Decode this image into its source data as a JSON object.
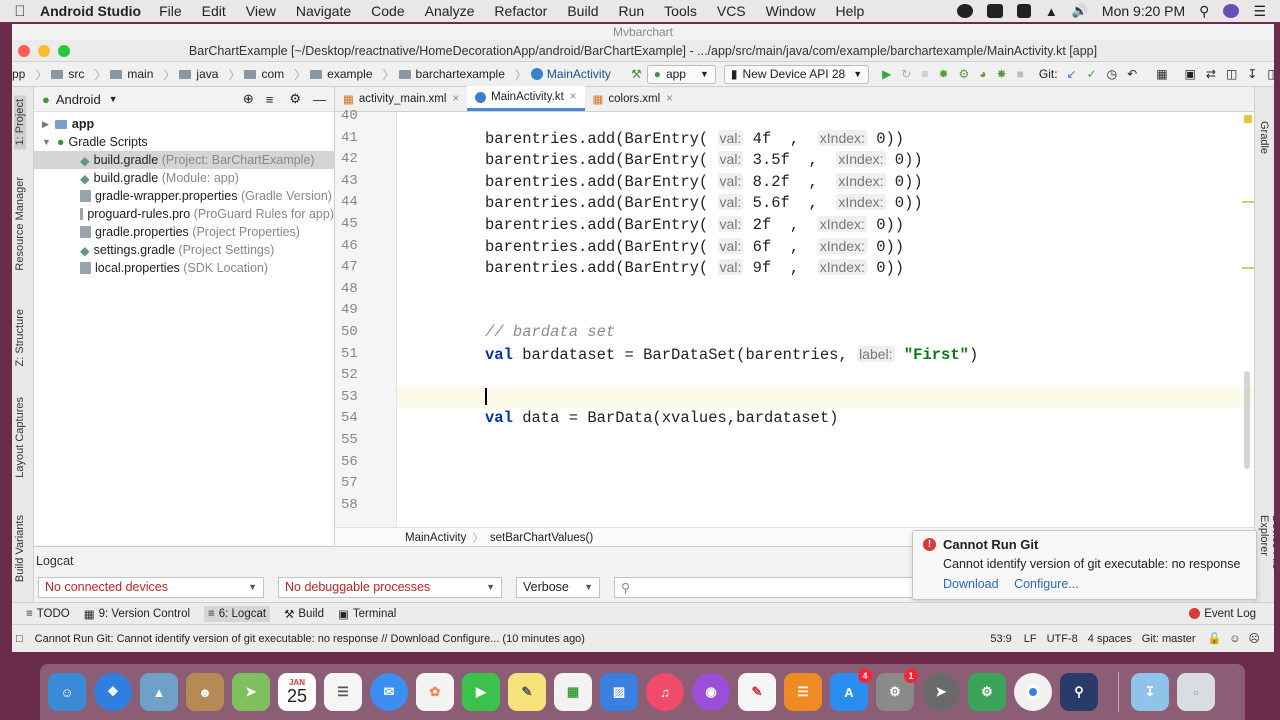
{
  "macmenu": {
    "app": "Android Studio",
    "items": [
      "File",
      "Edit",
      "View",
      "Navigate",
      "Code",
      "Analyze",
      "Refactor",
      "Build",
      "Run",
      "Tools",
      "VCS",
      "Window",
      "Help"
    ],
    "clock": "Mon 9:20 PM"
  },
  "window": {
    "tiny_title": "Mvbarchart",
    "title": "BarChartExample [~/Desktop/reactnative/HomeDecorationApp/android/BarChartExample] - .../app/src/main/java/com/example/barchartexample/MainActivity.kt [app]"
  },
  "navbar": {
    "crumbs": [
      "pp",
      "src",
      "main",
      "java",
      "com",
      "example",
      "barchartexample"
    ],
    "current_file": "MainActivity",
    "run_config": "app",
    "device": "New Device API 28",
    "git_label": "Git:"
  },
  "left_tool_tabs": [
    "1: Project",
    "Resource Manager",
    "Z: Structure",
    "Layout Captures",
    "Build Variants"
  ],
  "right_tool_tabs": [
    "Gradle",
    "Device File Explorer"
  ],
  "project": {
    "view": "Android",
    "tree": [
      {
        "label": "app",
        "note": "",
        "indent": 0,
        "bold": true
      },
      {
        "label": "Gradle Scripts",
        "note": "",
        "indent": 0,
        "bold": false
      },
      {
        "label": "build.gradle",
        "note": "(Project: BarChartExample)",
        "indent": 1,
        "selected": true
      },
      {
        "label": "build.gradle",
        "note": "(Module: app)",
        "indent": 1
      },
      {
        "label": "gradle-wrapper.properties",
        "note": "(Gradle Version)",
        "indent": 1
      },
      {
        "label": "proguard-rules.pro",
        "note": "(ProGuard Rules for app)",
        "indent": 1
      },
      {
        "label": "gradle.properties",
        "note": "(Project Properties)",
        "indent": 1
      },
      {
        "label": "settings.gradle",
        "note": "(Project Settings)",
        "indent": 1
      },
      {
        "label": "local.properties",
        "note": "(SDK Location)",
        "indent": 1
      }
    ]
  },
  "editor": {
    "tabs": [
      {
        "label": "activity_main.xml",
        "active": false
      },
      {
        "label": "MainActivity.kt",
        "active": true
      },
      {
        "label": "colors.xml",
        "active": false
      }
    ],
    "lines": [
      {
        "n": "40",
        "parts": []
      },
      {
        "n": "41",
        "parts": [
          {
            "t": "barentries.add(BarEntry( "
          },
          {
            "h": "val:"
          },
          {
            "t": " 4f  ,  "
          },
          {
            "h": "xIndex:"
          },
          {
            "t": " 0))"
          }
        ]
      },
      {
        "n": "42",
        "parts": [
          {
            "t": "barentries.add(BarEntry( "
          },
          {
            "h": "val:"
          },
          {
            "t": " 3.5f  ,  "
          },
          {
            "h": "xIndex:"
          },
          {
            "t": " 0))"
          }
        ]
      },
      {
        "n": "43",
        "parts": [
          {
            "t": "barentries.add(BarEntry( "
          },
          {
            "h": "val:"
          },
          {
            "t": " 8.2f  ,  "
          },
          {
            "h": "xIndex:"
          },
          {
            "t": " 0))"
          }
        ]
      },
      {
        "n": "44",
        "parts": [
          {
            "t": "barentries.add(BarEntry( "
          },
          {
            "h": "val:"
          },
          {
            "t": " 5.6f  ,  "
          },
          {
            "h": "xIndex:"
          },
          {
            "t": " 0))"
          }
        ]
      },
      {
        "n": "45",
        "parts": [
          {
            "t": "barentries.add(BarEntry( "
          },
          {
            "h": "val:"
          },
          {
            "t": " 2f  ,  "
          },
          {
            "h": "xIndex:"
          },
          {
            "t": " 0))"
          }
        ]
      },
      {
        "n": "46",
        "parts": [
          {
            "t": "barentries.add(BarEntry( "
          },
          {
            "h": "val:"
          },
          {
            "t": " 6f  ,  "
          },
          {
            "h": "xIndex:"
          },
          {
            "t": " 0))"
          }
        ]
      },
      {
        "n": "47",
        "parts": [
          {
            "t": "barentries.add(BarEntry( "
          },
          {
            "h": "val:"
          },
          {
            "t": " 9f  ,  "
          },
          {
            "h": "xIndex:"
          },
          {
            "t": " 0))"
          }
        ]
      },
      {
        "n": "48",
        "parts": []
      },
      {
        "n": "49",
        "parts": []
      },
      {
        "n": "50",
        "parts": [
          {
            "c": "// bardata set"
          }
        ]
      },
      {
        "n": "51",
        "parts": [
          {
            "k": "val"
          },
          {
            "t": " bardataset = BarDataSet(barentries, "
          },
          {
            "h": "label:"
          },
          {
            "t": " "
          },
          {
            "s": "\"First\""
          },
          {
            "t": ")"
          }
        ]
      },
      {
        "n": "52",
        "parts": []
      },
      {
        "n": "53",
        "parts": [],
        "current": true
      },
      {
        "n": "54",
        "parts": [
          {
            "k": "val"
          },
          {
            "t": " data = BarData(xvalues,bardataset)"
          }
        ]
      },
      {
        "n": "55",
        "parts": []
      },
      {
        "n": "56",
        "parts": []
      },
      {
        "n": "57",
        "parts": []
      },
      {
        "n": "58",
        "parts": []
      }
    ],
    "breadcrumb": [
      "MainActivity",
      "setBarChartValues()"
    ]
  },
  "logcat": {
    "title": "Logcat",
    "device": "No connected devices",
    "process": "No debuggable processes",
    "level": "Verbose",
    "search_placeholder": ""
  },
  "notification": {
    "title": "Cannot Run Git",
    "body": "Cannot identify version of git executable: no response",
    "link1": "Download",
    "link2": "Configure..."
  },
  "bottom_tabs": [
    "TODO",
    "9: Version Control",
    "6: Logcat",
    "Build",
    "Terminal"
  ],
  "event_log": "Event Log",
  "status": {
    "message": "Cannot Run Git: Cannot identify version of git executable: no response // Download  Configure... (10 minutes ago)",
    "position": "53:9",
    "line_sep": "LF",
    "encoding": "UTF-8",
    "indent": "4 spaces",
    "git": "Git: master"
  },
  "dock": {
    "calendar_month": "JAN",
    "calendar_day": "25",
    "badge_appstore": "4",
    "badge_settings": "1"
  }
}
